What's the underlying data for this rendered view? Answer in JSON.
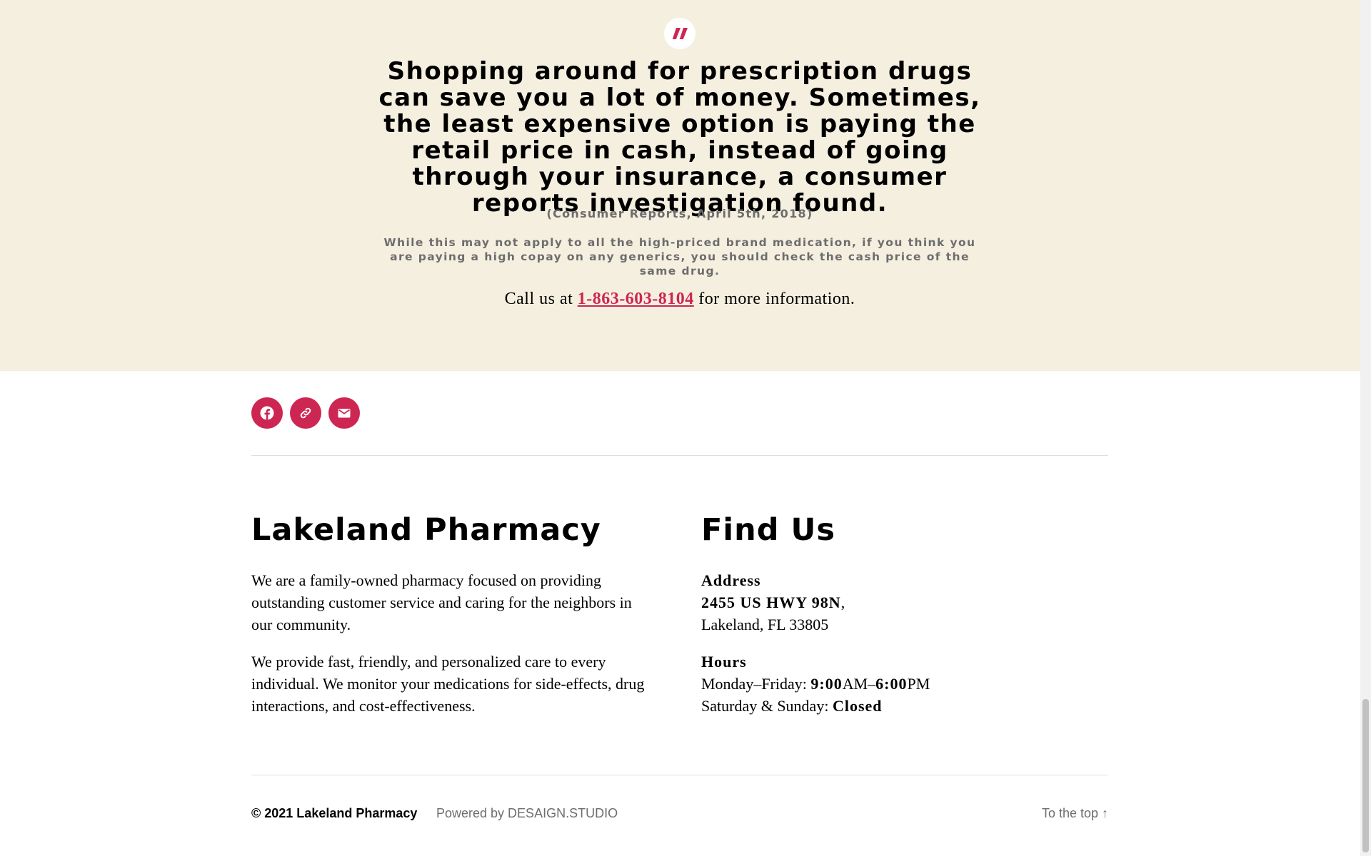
{
  "quote": {
    "icon": "quote-icon",
    "text": "Shopping around for prescription drugs can save you a lot of money. Sometimes, the least expensive option is paying the retail price in cash, instead of going through your insurance, a consumer reports investigation found.",
    "citation": "(Consumer Reports, April 5th, 2018)",
    "note": "While this may not apply to all the high-priced brand medication, if you think you are paying a high copay on any generics, you should check the cash price of the same drug.",
    "call_prefix": "Call us at",
    "phone": "1-863-603-8104",
    "call_suffix": "for more information."
  },
  "social": {
    "items": [
      {
        "icon": "facebook-icon"
      },
      {
        "icon": "link-icon"
      },
      {
        "icon": "mail-icon"
      }
    ]
  },
  "footer": {
    "about": {
      "title": "Lakeland Pharmacy",
      "p1": "We are a family-owned pharmacy focused on providing outstanding customer service and caring for the neighbors in our community.",
      "p2": "We provide fast, friendly, and personalized care to every individual. We monitor your medications for side-effects, drug interactions, and cost-effectiveness."
    },
    "find": {
      "title": "Find Us",
      "address_label": "Address",
      "address_line1": "2455 US HWY 98N",
      "address_line1_suffix": ",",
      "address_line2": "Lakeland, FL 33805",
      "hours_label": "Hours",
      "weekdays_label": "Monday–Friday:",
      "open_time": "9:00",
      "open_ampm": "AM–",
      "close_time": "6:00",
      "close_ampm": "PM",
      "weekend_label": "Saturday & Sunday:",
      "weekend_value": "Closed"
    },
    "copyright": "© 2021 Lakeland Pharmacy",
    "powered": "Powered by DESAIGN.STUDIO",
    "to_top": "To the top ↑"
  },
  "colors": {
    "accent": "#cd2653",
    "band": "#f5efe0",
    "muted": "#6d6d6d"
  }
}
